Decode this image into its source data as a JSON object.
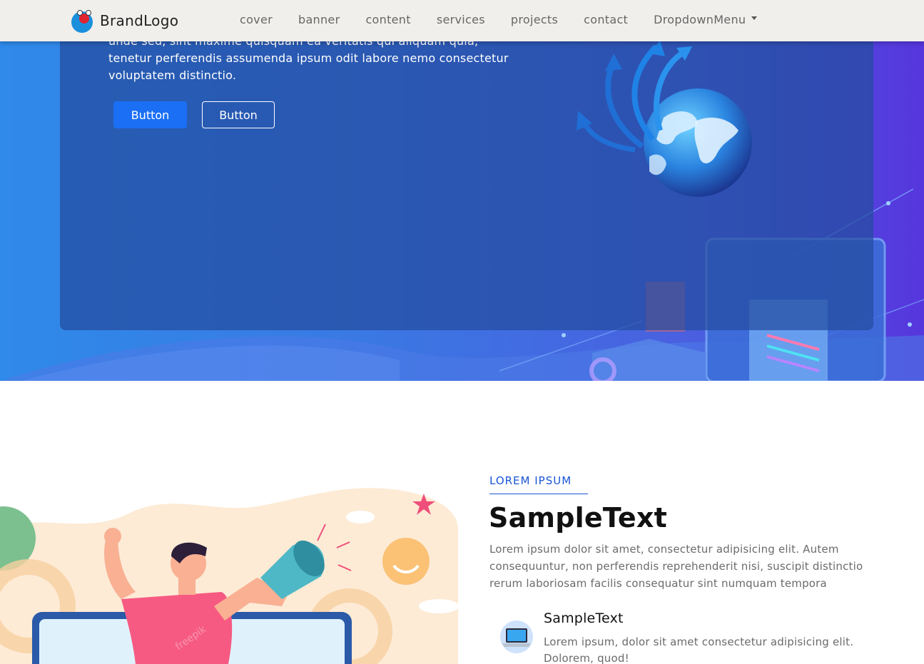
{
  "navbar": {
    "brand_label": "BrandLogo",
    "links": [
      "cover",
      "banner",
      "content",
      "services",
      "projects",
      "contact"
    ],
    "dropdown_label": "DropdownMenu"
  },
  "hero": {
    "paragraph": "unde sed, sint maxime quisquam ea veritatis qui aliquam quia, tenetur perferendis assumenda ipsum odit labore nemo consectetur voluptatem distinctio.",
    "primary_button_label": "Button",
    "secondary_button_label": "Button"
  },
  "content": {
    "eyebrow": "LOREM IPSUM",
    "title": "SampleText",
    "description": "Lorem ipsum dolor sit amet, consectetur adipisicing elit. Autem consequuntur, non perferendis reprehenderit nisi, suscipit distinctio rerum laboriosam facilis consequatur sint numquam tempora",
    "feature": {
      "title": "SampleText",
      "description": "Lorem ipsum, dolor sit amet consectetur adipisicing elit. Dolorem, quod!",
      "icon": "laptop-icon"
    },
    "illustration_watermark": "freepik"
  },
  "colors": {
    "accent": "#1a55d6",
    "primary_button": "#1a6ff5",
    "navbar_bg": "#f1efec"
  }
}
